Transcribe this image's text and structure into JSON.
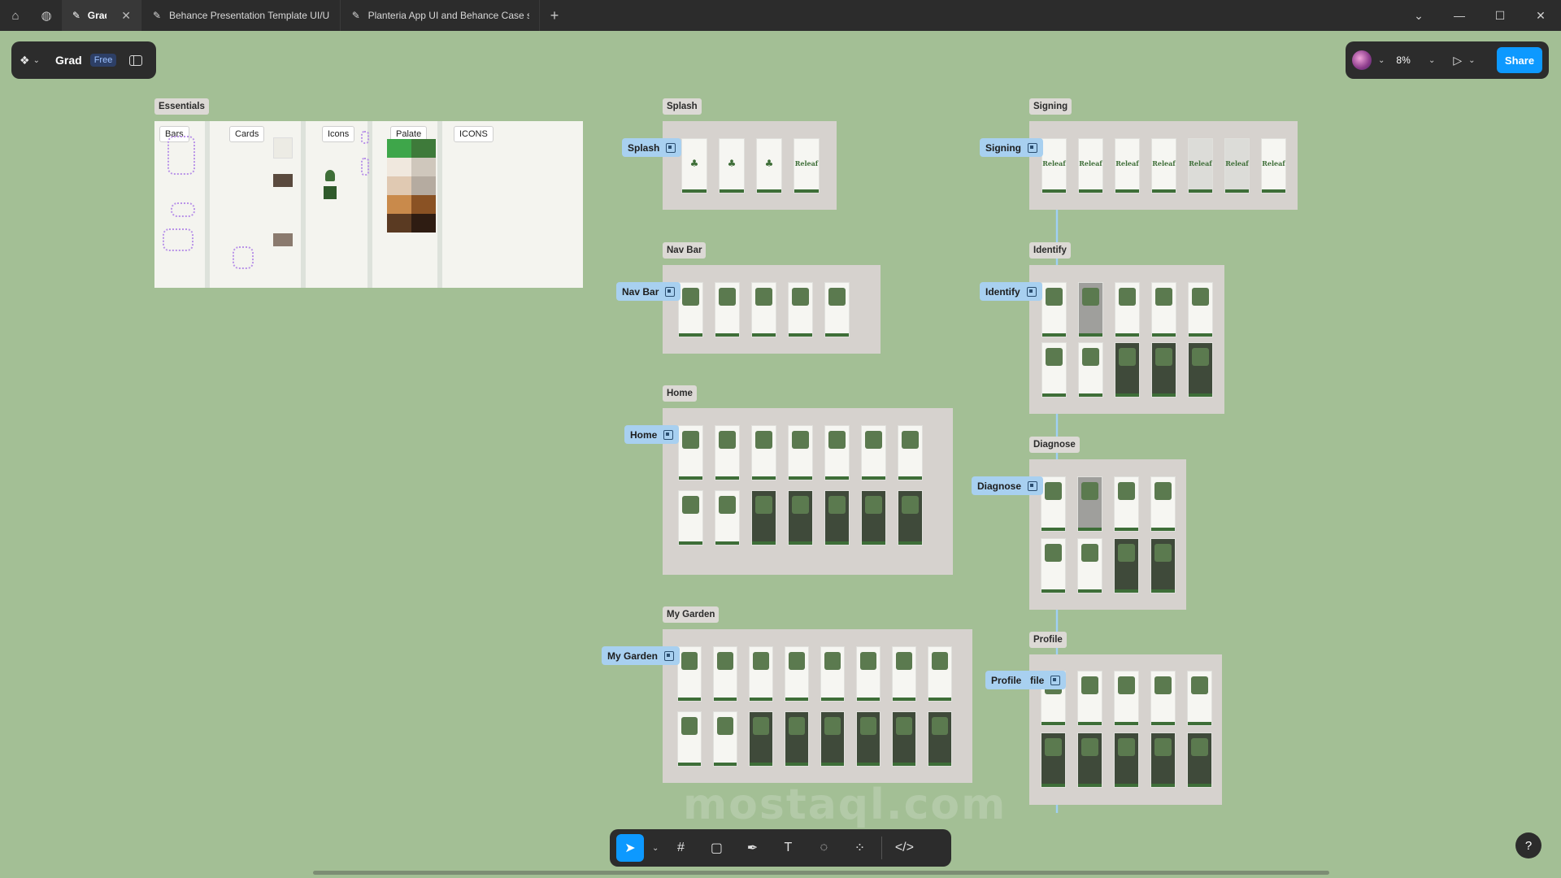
{
  "browser": {
    "tabs": [
      {
        "title": "Grad",
        "active": true
      },
      {
        "title": "Behance Presentation Template UI/U",
        "active": false
      },
      {
        "title": "Planteria App UI and Behance Case st",
        "active": false
      }
    ]
  },
  "toolbar": {
    "file_name": "Grad",
    "plan_badge": "Free",
    "zoom": "8%",
    "share_label": "Share"
  },
  "canvas": {
    "essentials": {
      "label": "Essentials",
      "tags": [
        "Bars",
        "Cards",
        "Icons",
        "Palate",
        "ICONS"
      ],
      "palette": [
        "#3ea64a",
        "#3e7a3a",
        "#f0e8de",
        "#cfc7bc",
        "#e0c9b2",
        "#b5aba0",
        "#c98a4b",
        "#8a5224",
        "#5a3a22",
        "#2e1c12"
      ]
    },
    "sections": [
      {
        "label": "Splash",
        "flow": "Splash"
      },
      {
        "label": "Nav Bar",
        "flow": "Nav Bar"
      },
      {
        "label": "Home",
        "flow": "Home"
      },
      {
        "label": "My Garden",
        "flow": "My Garden"
      },
      {
        "label": "Signing",
        "flow": "Signing"
      },
      {
        "label": "Identify",
        "flow": "Identify"
      },
      {
        "label": "Diagnose",
        "flow": "Diagnose"
      },
      {
        "label": "Profile",
        "flow": "Profile"
      }
    ],
    "profile_extra_flow": "file",
    "logo_text": "Releaf"
  },
  "watermark": "mostaql.com",
  "help_label": "?"
}
